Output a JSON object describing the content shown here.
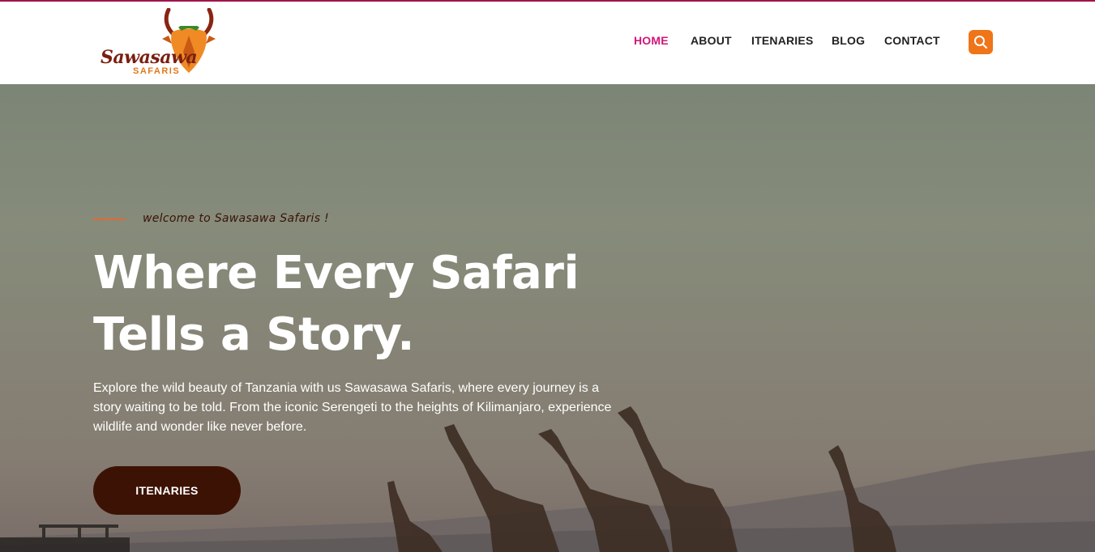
{
  "brand": {
    "name": "Sawasawa",
    "sub": "SAFARIS",
    "colors": {
      "accent": "#f07418",
      "nav_active": "#d0177a",
      "dark_brown": "#3c1204",
      "top_line": "#a0144d"
    }
  },
  "nav": {
    "items": [
      {
        "label": "HOME",
        "active": true
      },
      {
        "label": "ABOUT",
        "active": false
      },
      {
        "label": "ITENARIES",
        "active": false
      },
      {
        "label": "BLOG",
        "active": false
      },
      {
        "label": "CONTACT",
        "active": false
      }
    ],
    "search_icon": "search-icon"
  },
  "hero": {
    "eyebrow": "welcome to Sawasawa Safaris !",
    "headline_line1": "Where Every Safari",
    "headline_line2": "Tells a Story.",
    "description": "Explore the wild beauty of Tanzania with us Sawasawa Safaris, where every journey is a story waiting to be told. From the iconic Serengeti to the heights of Kilimanjaro, experience wildlife and wonder like never before.",
    "cta_label": "ITENARIES"
  }
}
